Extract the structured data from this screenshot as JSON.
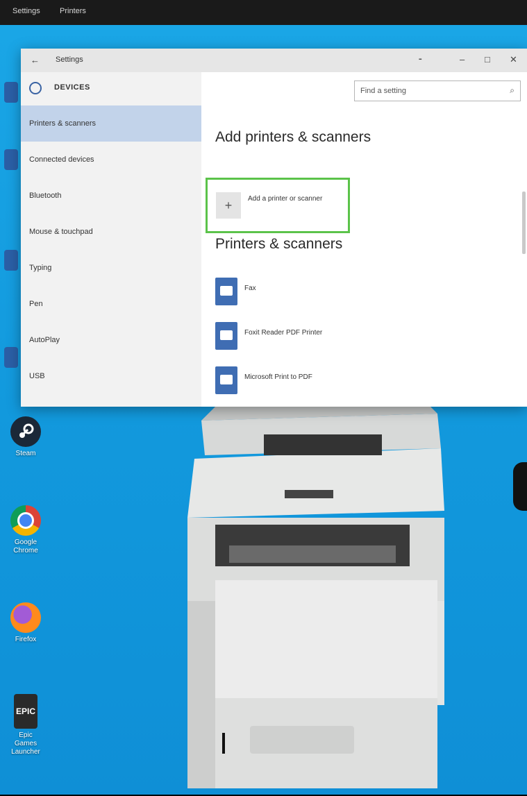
{
  "topbar": {
    "left_item": "Settings",
    "right_item": "Printers"
  },
  "window": {
    "title": "Settings",
    "controls": {
      "pin": "⁃",
      "minimize": "–",
      "maximize": "□",
      "close": "✕"
    },
    "section": "DEVICES",
    "search": {
      "placeholder": "Find a setting"
    },
    "nav": [
      {
        "label": "Printers & scanners",
        "selected": true
      },
      {
        "label": "Connected devices"
      },
      {
        "label": "Bluetooth"
      },
      {
        "label": "Mouse & touchpad"
      },
      {
        "label": "Typing"
      },
      {
        "label": "Pen"
      },
      {
        "label": "AutoPlay"
      },
      {
        "label": "USB"
      }
    ],
    "add_heading": "Add printers & scanners",
    "add_button": "Add a printer or scanner",
    "list_heading": "Printers & scanners",
    "printers": [
      {
        "name": "Fax",
        "icon": "printer-icon"
      },
      {
        "name": "Foxit Reader PDF Printer",
        "icon": "printer-icon"
      },
      {
        "name": "Microsoft Print to PDF",
        "icon": "pdf-printer-icon"
      }
    ]
  },
  "desktop_icons": [
    {
      "label": "Steam",
      "icon": "steam-icon"
    },
    {
      "label": "Google Chrome",
      "icon": "chrome-icon"
    },
    {
      "label": "Firefox",
      "icon": "firefox-icon"
    },
    {
      "label": "Epic Games Launcher",
      "icon": "epic-games-icon"
    }
  ],
  "colors": {
    "desktop": "#1299dd",
    "selected_nav": "#c2d3ea",
    "highlight_border": "#5bc34a",
    "printer_icon": "#3f6db3"
  }
}
